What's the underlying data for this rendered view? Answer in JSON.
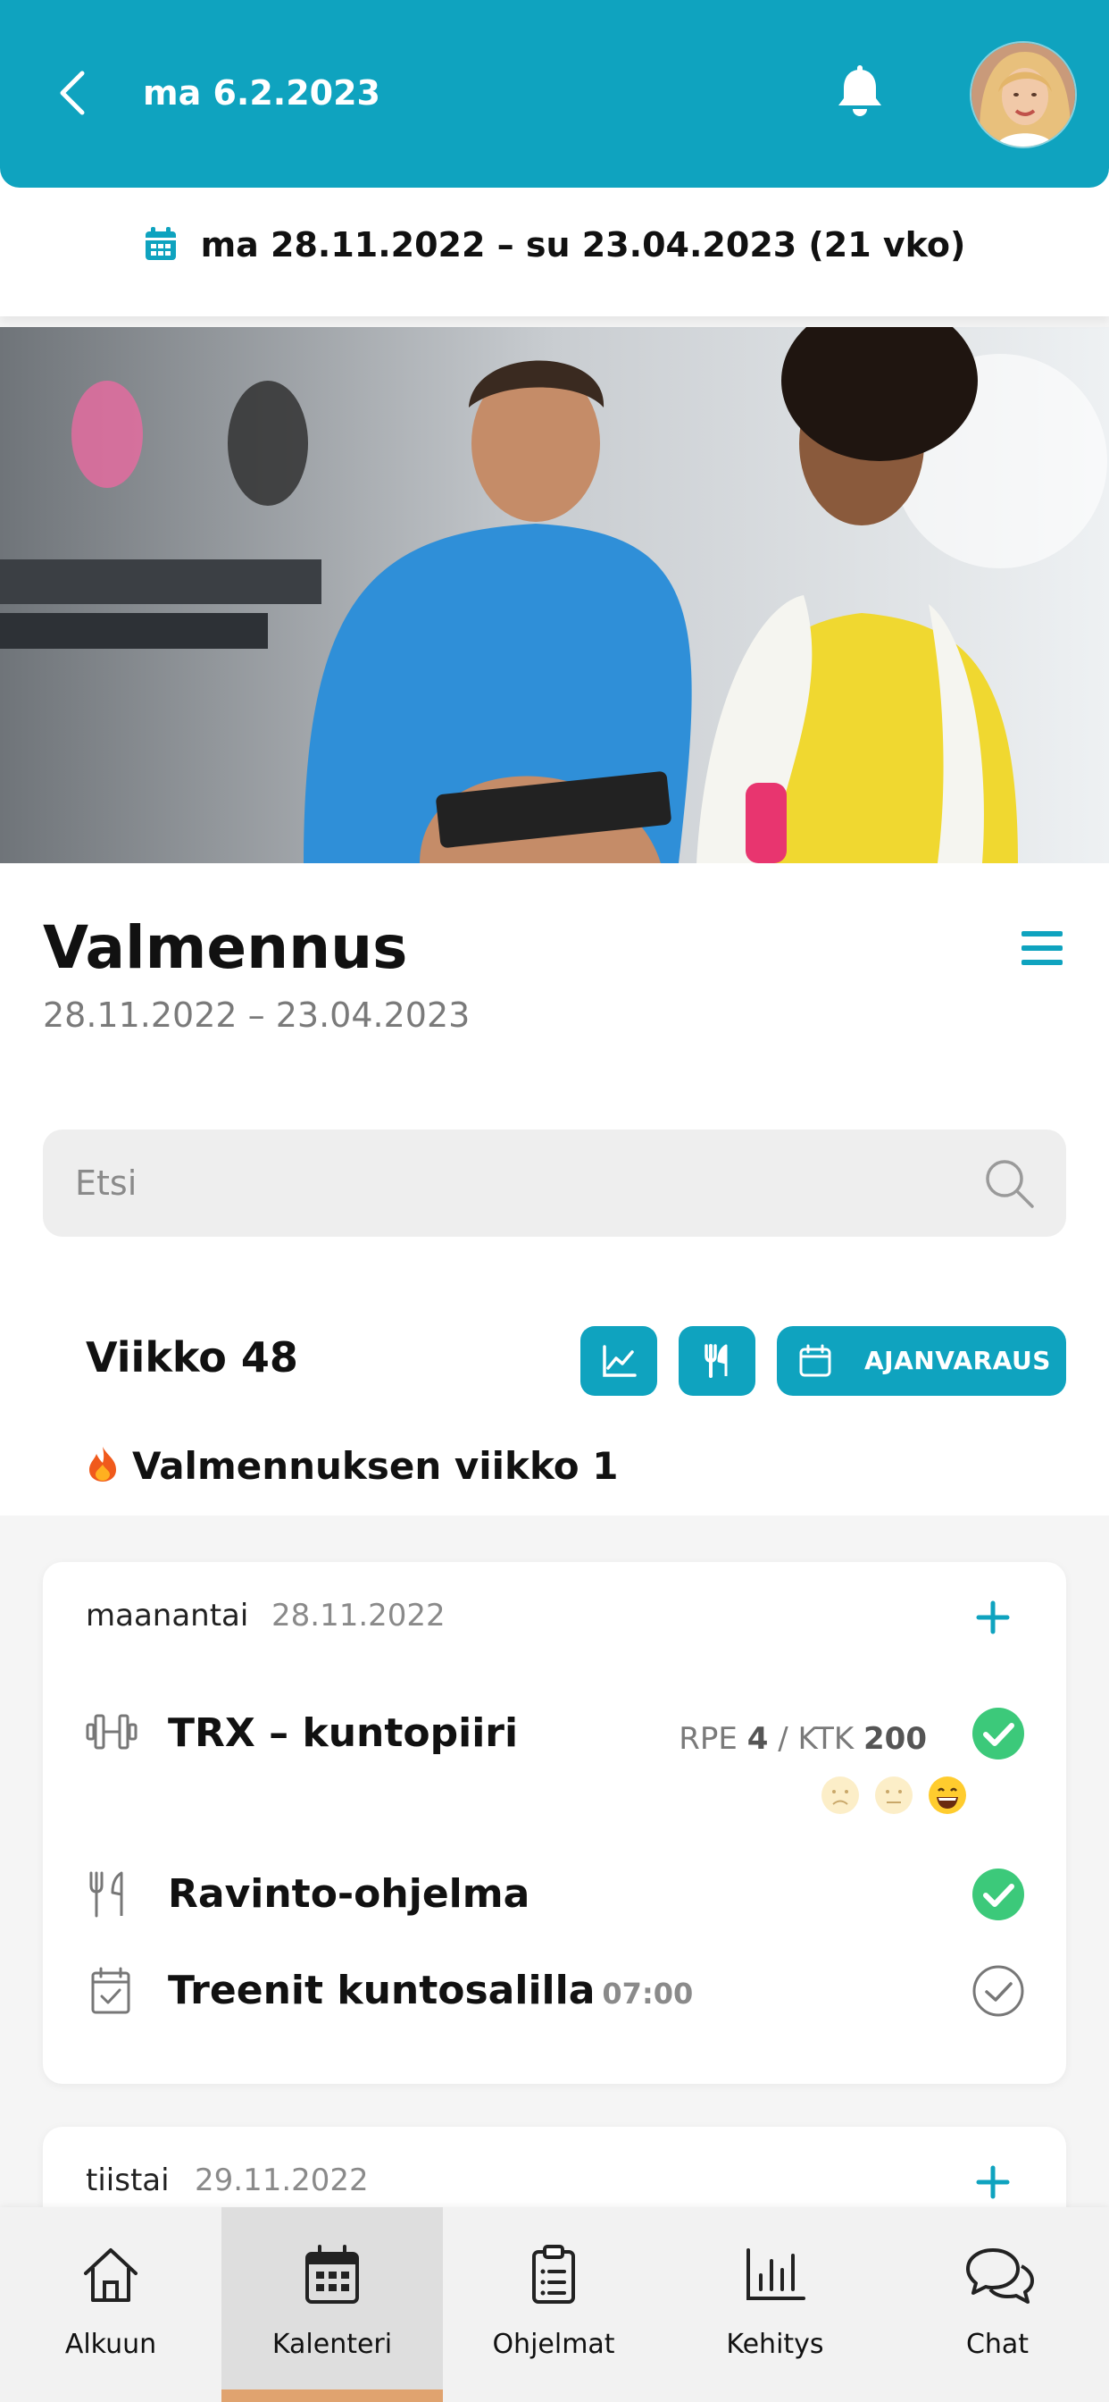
{
  "header": {
    "date": "ma 6.2.2023",
    "icons": [
      "back-icon",
      "bell-icon",
      "avatar"
    ]
  },
  "program_range": {
    "text": "ma 28.11.2022 – su 23.04.2023 (21 vko)",
    "icon": "calendar-icon"
  },
  "program": {
    "title": "Valmennus",
    "dates": "28.11.2022 – 23.04.2023"
  },
  "search": {
    "placeholder": "Etsi"
  },
  "week": {
    "title": "Viikko 48",
    "booking_label": "AJANVARAUS",
    "note": "Valmennuksen viikko 1",
    "buttons": [
      "chart-icon",
      "cutlery-icon",
      "calendar-icon"
    ]
  },
  "days": [
    {
      "name": "maanantai",
      "date": "28.11.2022",
      "items": [
        {
          "icon": "dumbbell-icon",
          "title": "TRX – kuntopiiri",
          "rpe_label": "RPE",
          "rpe": "4",
          "ktk_label": "KTK",
          "ktk": "200",
          "done": true
        },
        {
          "icon": "cutlery-icon",
          "title": "Ravinto-ohjelma",
          "done": true
        },
        {
          "icon": "calendar-check-icon",
          "title": "Treenit kuntosalilla",
          "time": "07:00",
          "done": false
        }
      ],
      "moods": [
        "sad",
        "neutral",
        "happy"
      ],
      "selected_mood": "happy"
    },
    {
      "name": "tiistai",
      "date": "29.11.2022"
    }
  ],
  "nav": {
    "items": [
      {
        "label": "Alkuun",
        "icon": "home-icon"
      },
      {
        "label": "Kalenteri",
        "icon": "calendar-icon"
      },
      {
        "label": "Ohjelmat",
        "icon": "clipboard-icon"
      },
      {
        "label": "Kehitys",
        "icon": "bar-chart-icon"
      },
      {
        "label": "Chat",
        "icon": "chat-icon"
      }
    ],
    "active": "Kalenteri"
  },
  "colors": {
    "brand": "#0fa3bf",
    "success": "#3cc97a",
    "nav_active_bar": "#e0a36f"
  }
}
